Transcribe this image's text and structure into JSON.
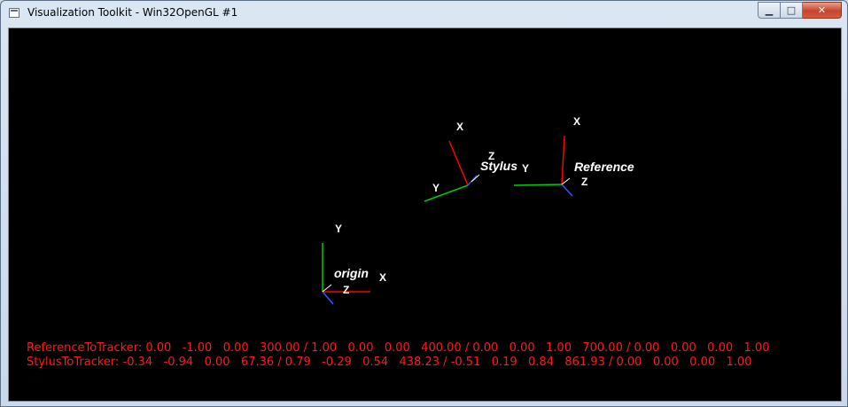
{
  "window": {
    "title": "Visualization Toolkit - Win32OpenGL #1",
    "buttons": {
      "minimize": "▁",
      "maximize": "□",
      "close": "✕"
    }
  },
  "scene": {
    "axis_label_color": "#ffffff",
    "axis_colors": {
      "x": "#ff0000",
      "y": "#00cc00",
      "z": "#3355ff"
    },
    "origin": {
      "name": "origin",
      "labels": {
        "x": "X",
        "y": "Y",
        "z": "Z"
      }
    },
    "stylus": {
      "name": "Stylus",
      "labels": {
        "x": "X",
        "y": "Y",
        "z": "Z"
      }
    },
    "reference": {
      "name": "Reference",
      "labels": {
        "x": "X",
        "y": "Y",
        "z": "Z"
      }
    }
  },
  "readout": {
    "color": "#ff1a1a",
    "reference_to_tracker": "ReferenceToTracker: 0.00   -1.00   0.00   300.00 / 1.00   0.00   0.00   400.00 / 0.00   0.00   1.00   700.00 / 0.00   0.00   0.00   1.00",
    "stylus_to_tracker": "StylusToTracker: -0.34   -0.94   0.00   67.36 / 0.79   -0.29   0.54   438.23 / -0.51   0.19   0.84   861.93 / 0.00   0.00   0.00   1.00"
  }
}
